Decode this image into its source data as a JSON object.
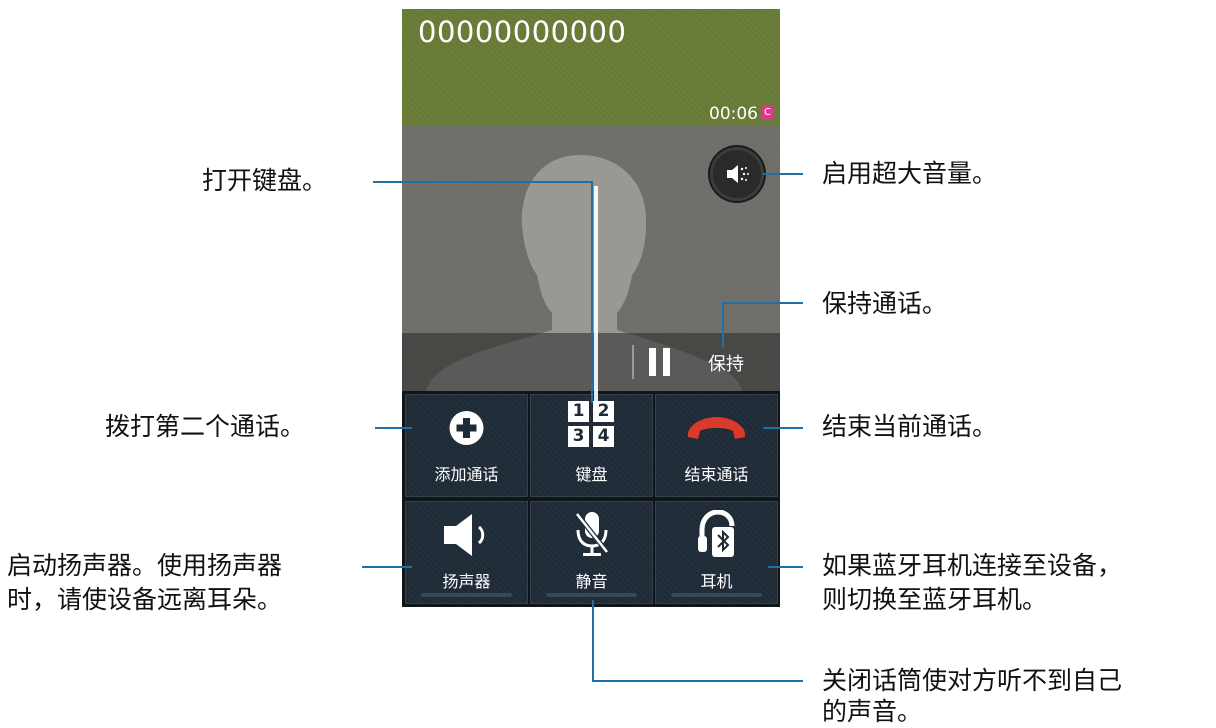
{
  "call": {
    "number": "00000000000",
    "timer": "00:06",
    "sim_badge": "C",
    "hold_label": "保持"
  },
  "buttons": {
    "add_call": "添加通话",
    "keypad": "键盘",
    "keypad_digits": [
      "1",
      "2",
      "3",
      "4"
    ],
    "end_call": "结束通话",
    "speaker": "扬声器",
    "mute": "静音",
    "headset": "耳机"
  },
  "annotations": {
    "open_keypad": "打开键盘。",
    "extra_volume": "启用超大音量。",
    "hold_call": "保持通话。",
    "add_call": "拨打第二个通话。",
    "end_call": "结束当前通话。",
    "speaker_line1": "启动扬声器。使用扬声器",
    "speaker_line2": "时，请使设备远离耳朵。",
    "headset_line1": "如果蓝牙耳机连接至设备，",
    "headset_line2": "则切换至蓝牙耳机。",
    "mute_line1": "关闭话筒使对方听不到自己",
    "mute_line2": "的声音。"
  },
  "colors": {
    "header_bg": "#6b7f3a",
    "button_bg": "#1e2b37",
    "end_call_red": "#d93a2b",
    "callout_line": "#1f6fa8"
  },
  "icons": {
    "add_call": "plus-circle-icon",
    "keypad": "keypad-icon",
    "end_call": "phone-hangup-icon",
    "speaker": "speaker-icon",
    "mute": "mic-off-icon",
    "headset": "bluetooth-headset-icon",
    "extra_volume": "extra-volume-icon",
    "hold": "pause-icon"
  }
}
